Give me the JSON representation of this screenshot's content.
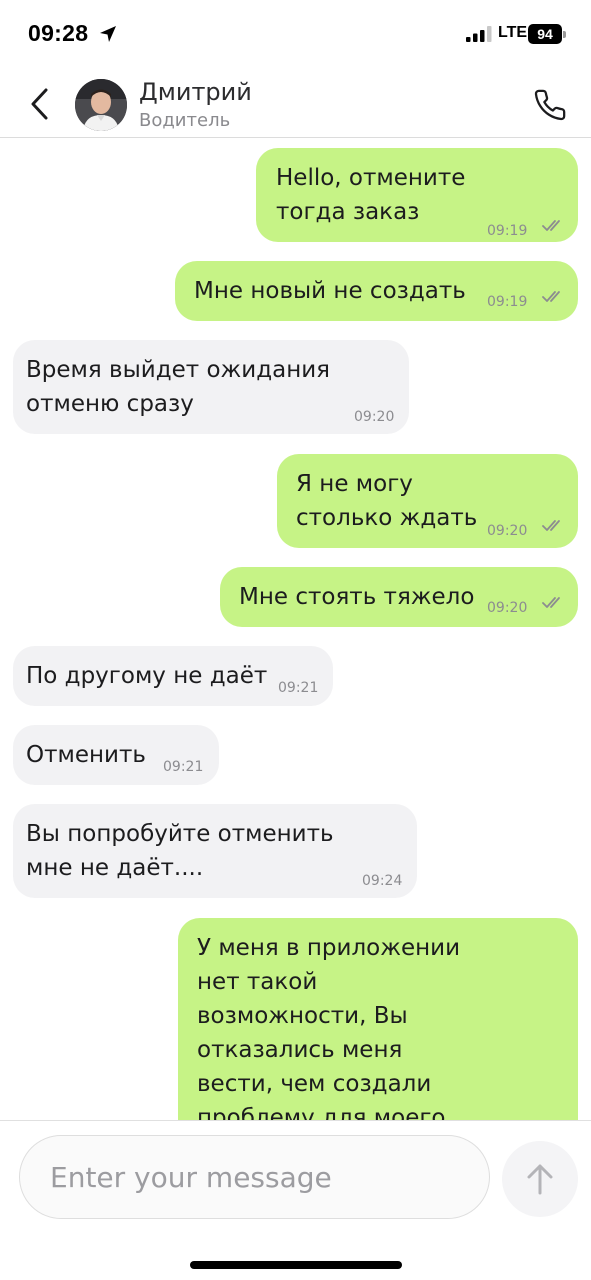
{
  "status_bar": {
    "time": "09:28",
    "network": "LTE",
    "battery": "94"
  },
  "header": {
    "contact_name": "Дмитрий",
    "contact_role": "Водитель"
  },
  "messages": [
    {
      "direction": "out",
      "text": "Hello, отмените\nтогда заказ",
      "time": "09:19",
      "read": true
    },
    {
      "direction": "out",
      "text": "Мне новый не создать",
      "time": "09:19",
      "read": true
    },
    {
      "direction": "in",
      "text": "Время выйдет ожидания\nотменю сразу",
      "time": "09:20"
    },
    {
      "direction": "out",
      "text": "Я не могу\nстолько ждать",
      "time": "09:20",
      "read": true
    },
    {
      "direction": "out",
      "text": "Мне стоять тяжело",
      "time": "09:20",
      "read": true
    },
    {
      "direction": "in",
      "text": "По другому не даёт",
      "time": "09:21"
    },
    {
      "direction": "in",
      "text": "Отменить",
      "time": "09:21"
    },
    {
      "direction": "in",
      "text": "Вы попробуйте отменить\nмне не даёт....",
      "time": "09:24"
    },
    {
      "direction": "out",
      "text": "У меня в приложении\nнет такой\nвозможности, Вы\nотказались меня\nвести, чем создали\nпроблему для моего"
    }
  ],
  "composer": {
    "placeholder": "Enter your message"
  },
  "colors": {
    "outgoing_bubble": "#c6f386",
    "incoming_bubble": "#f2f2f4"
  }
}
